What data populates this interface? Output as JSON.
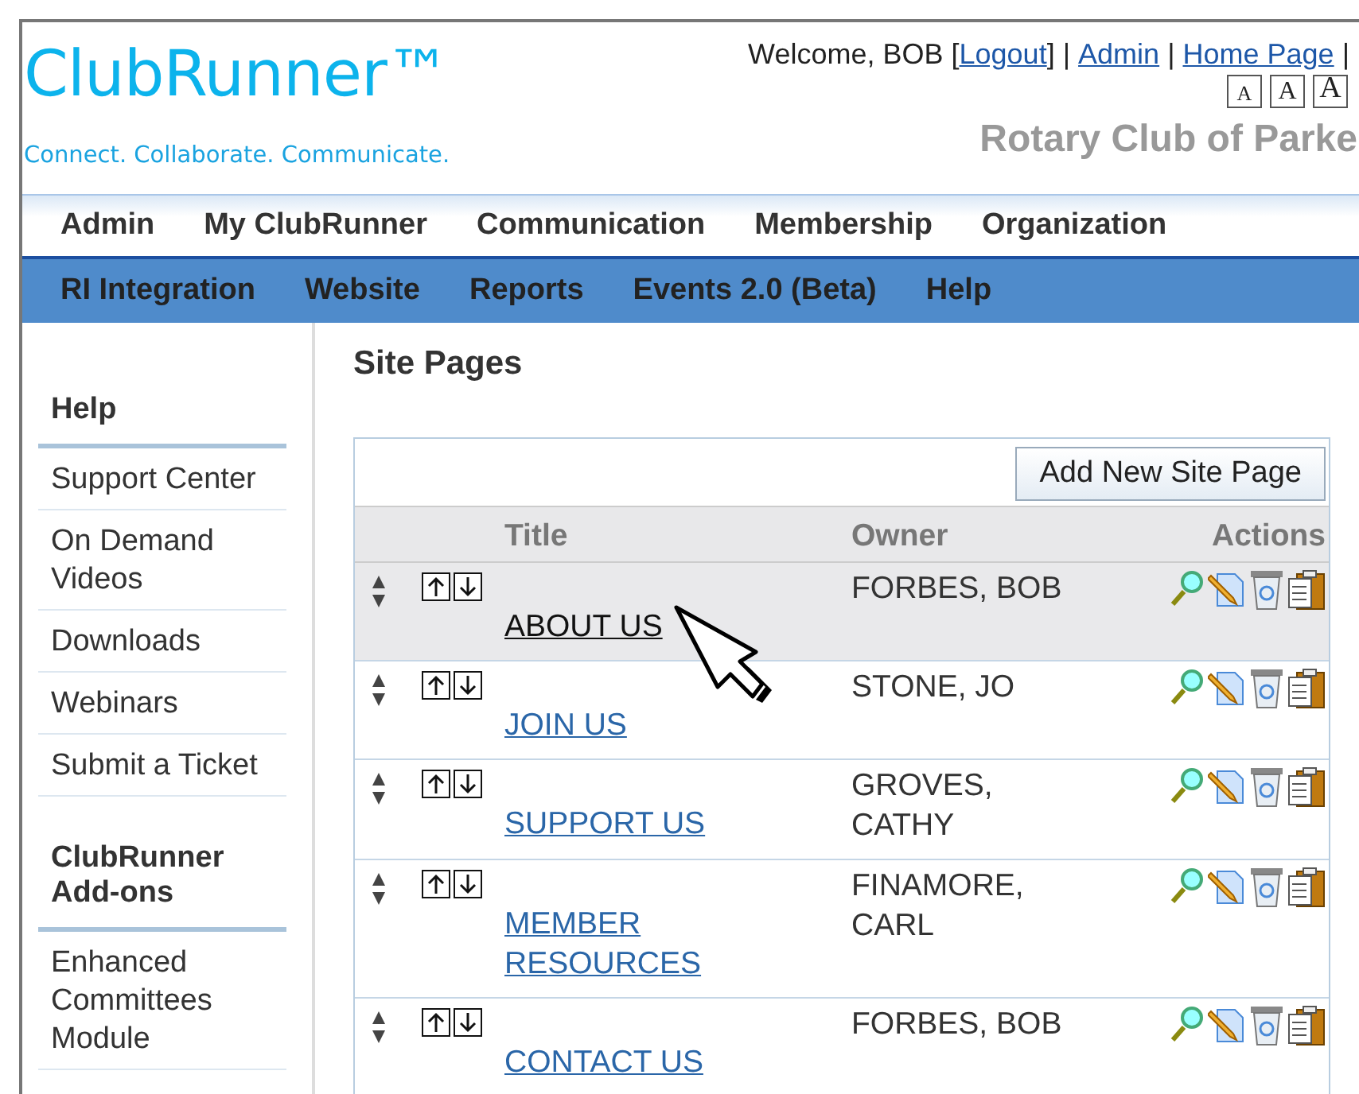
{
  "header": {
    "logo": "ClubRunner™",
    "tagline": "Connect. Collaborate. Communicate.",
    "welcome": "Welcome, BOB",
    "segments": [
      {
        "kind": "open",
        "text": "["
      },
      {
        "kind": "link",
        "text": "Logout"
      },
      {
        "kind": "close",
        "text": "]"
      },
      {
        "kind": "pipe",
        "text": "|"
      },
      {
        "kind": "link",
        "text": "Admin"
      },
      {
        "kind": "pipe",
        "text": "|"
      },
      {
        "kind": "link",
        "text": "Home Page"
      },
      {
        "kind": "pipe",
        "text": "|"
      }
    ],
    "font_sizes": [
      "A",
      "A",
      "A"
    ],
    "club_name": "Rotary Club of Parke"
  },
  "menu_primary": [
    "Admin",
    "My ClubRunner",
    "Communication",
    "Membership",
    "Organization"
  ],
  "menu_secondary": [
    "RI Integration",
    "Website",
    "Reports",
    "Events 2.0 (Beta)",
    "Help"
  ],
  "sidebar": [
    {
      "title": "Help",
      "items": [
        "Support Center",
        "On Demand Videos",
        "Downloads",
        "Webinars",
        "Submit a Ticket"
      ]
    },
    {
      "title": "ClubRunner Add-ons",
      "items": [
        "Enhanced Committees Module"
      ]
    }
  ],
  "content": {
    "heading": "Site Pages",
    "add_button": "Add New Site Page",
    "columns": [
      "Title",
      "Owner",
      "Actions"
    ],
    "rows": [
      {
        "title": "ABOUT US",
        "owner": "FORBES, BOB",
        "hovered": true
      },
      {
        "title": "JOIN US",
        "owner": "STONE, JO",
        "hovered": false
      },
      {
        "title": "SUPPORT US",
        "owner": "GROVES, CATHY",
        "hovered": false
      },
      {
        "title": "MEMBER RESOURCES",
        "owner": "FINAMORE, CARL",
        "hovered": false
      },
      {
        "title": "CONTACT US",
        "owner": "FORBES, BOB",
        "hovered": false
      }
    ]
  }
}
